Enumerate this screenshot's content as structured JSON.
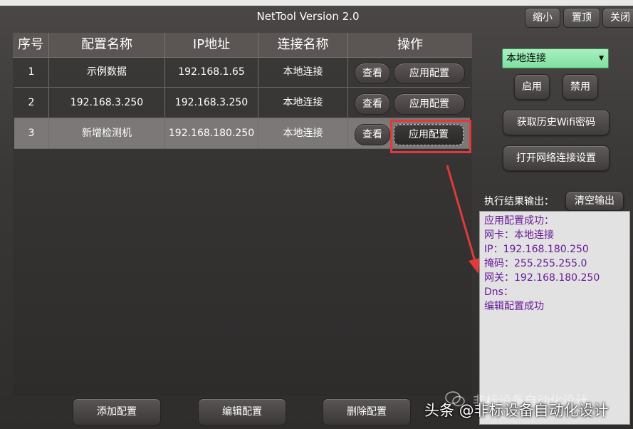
{
  "window": {
    "title": "NetTool Version 2.0",
    "controls": {
      "minimize": "缩小",
      "pin_top": "置顶",
      "close": "关闭"
    }
  },
  "table": {
    "headers": [
      "序号",
      "配置名称",
      "IP地址",
      "连接名称",
      "操作"
    ],
    "rows": [
      {
        "index": "1",
        "name": "示例数据",
        "ip": "192.168.1.65",
        "connection": "本地连接",
        "view": "查看",
        "apply": "应用配置"
      },
      {
        "index": "2",
        "name": "192.168.3.250",
        "ip": "192.168.3.250",
        "connection": "本地连接",
        "view": "查看",
        "apply": "应用配置"
      },
      {
        "index": "3",
        "name": "新增检测机",
        "ip": "192.168.180.250",
        "connection": "本地连接",
        "view": "查看",
        "apply": "应用配置"
      }
    ],
    "selected_row": 3
  },
  "side": {
    "adapter_select": "本地连接",
    "enable": "启用",
    "disable": "禁用",
    "get_wifi": "获取历史Wifi密码",
    "open_network": "打开网络连接设置",
    "output_label": "执行结果输出：",
    "clear_output": "清空输出",
    "output_lines": [
      "应用配置成功：",
      "网卡：本地连接",
      "IP：192.168.180.250",
      "掩码：255.255.255.0",
      "网关：192.168.180.250",
      "Dns：",
      "编辑配置成功"
    ]
  },
  "bottom": {
    "add": "添加配置",
    "edit": "编辑配置",
    "delete": "删除配置"
  },
  "watermark": {
    "main": "头条 @非标设备自动化设计",
    "ghost": "非标设备自动化设计"
  },
  "colors": {
    "highlight_box": "#e03a3a",
    "output_text": "#6a1a9a",
    "combo_bg": "#8fe8b0"
  }
}
